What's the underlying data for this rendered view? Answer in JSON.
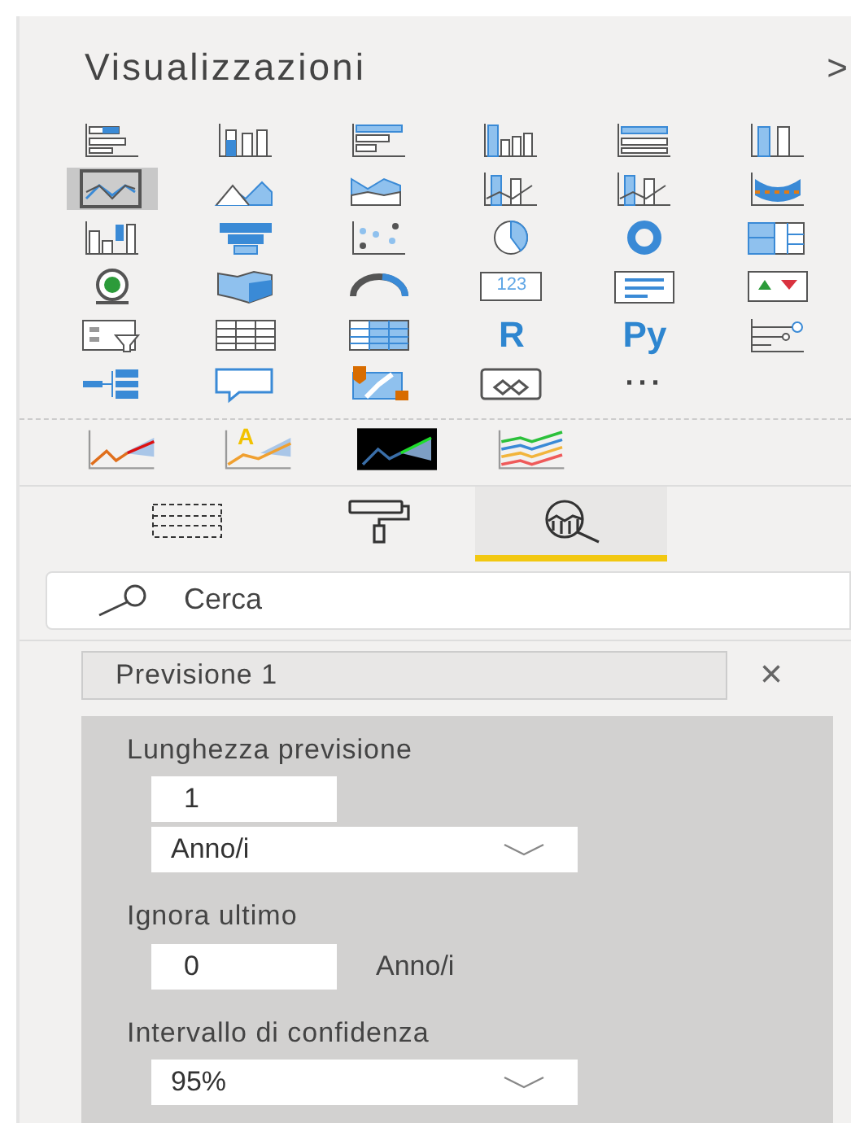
{
  "pane": {
    "title": "Visualizzazioni",
    "collapse": ">"
  },
  "visuals": [
    {
      "kind": "stacked-bar",
      "selected": false
    },
    {
      "kind": "stacked-column",
      "selected": false
    },
    {
      "kind": "clustered-bar",
      "selected": false
    },
    {
      "kind": "clustered-column",
      "selected": false
    },
    {
      "kind": "bar-100",
      "selected": false
    },
    {
      "kind": "column-100",
      "selected": false
    },
    {
      "kind": "line",
      "selected": true
    },
    {
      "kind": "area",
      "selected": false
    },
    {
      "kind": "stacked-area",
      "selected": false
    },
    {
      "kind": "line-column",
      "selected": false
    },
    {
      "kind": "line-column-2",
      "selected": false
    },
    {
      "kind": "ribbon",
      "selected": false
    },
    {
      "kind": "waterfall",
      "selected": false
    },
    {
      "kind": "funnel",
      "selected": false
    },
    {
      "kind": "scatter",
      "selected": false
    },
    {
      "kind": "pie",
      "selected": false
    },
    {
      "kind": "donut",
      "selected": false
    },
    {
      "kind": "treemap",
      "selected": false
    },
    {
      "kind": "globe",
      "selected": false
    },
    {
      "kind": "filled-map",
      "selected": false
    },
    {
      "kind": "gauge",
      "selected": false
    },
    {
      "kind": "card",
      "selected": false,
      "label": "123"
    },
    {
      "kind": "multirow-card",
      "selected": false
    },
    {
      "kind": "kpi",
      "selected": false
    },
    {
      "kind": "slicer",
      "selected": false
    },
    {
      "kind": "table",
      "selected": false
    },
    {
      "kind": "matrix",
      "selected": false
    },
    {
      "kind": "glyph",
      "selected": false,
      "label": "R"
    },
    {
      "kind": "glyph",
      "selected": false,
      "label": "Py"
    },
    {
      "kind": "influencers",
      "selected": false
    },
    {
      "kind": "decomposition",
      "selected": false
    },
    {
      "kind": "qa",
      "selected": false
    },
    {
      "kind": "arcgis",
      "selected": false
    },
    {
      "kind": "powerapps",
      "selected": false
    },
    {
      "kind": "more",
      "selected": false,
      "label": "···"
    }
  ],
  "custom_visuals": [
    {
      "kind": "forecast-line"
    },
    {
      "kind": "forecast-letter",
      "label": "A"
    },
    {
      "kind": "forecast-inverse"
    },
    {
      "kind": "multi-line"
    }
  ],
  "tabs": [
    {
      "kind": "fields",
      "selected": false
    },
    {
      "kind": "format",
      "selected": false
    },
    {
      "kind": "analytics",
      "selected": true
    }
  ],
  "search": {
    "placeholder": "Cerca"
  },
  "section": {
    "title": "Previsione 1",
    "close": "×",
    "fields": [
      {
        "kind": "number-dropdown",
        "label": "Lunghezza previsione",
        "value": "1",
        "unit": "Anno/i"
      },
      {
        "kind": "number-unit",
        "label": "Ignora ultimo",
        "value": "0",
        "unit": "Anno/i"
      },
      {
        "kind": "dropdown",
        "label": "Intervallo di confidenza",
        "value": "95%"
      }
    ]
  }
}
